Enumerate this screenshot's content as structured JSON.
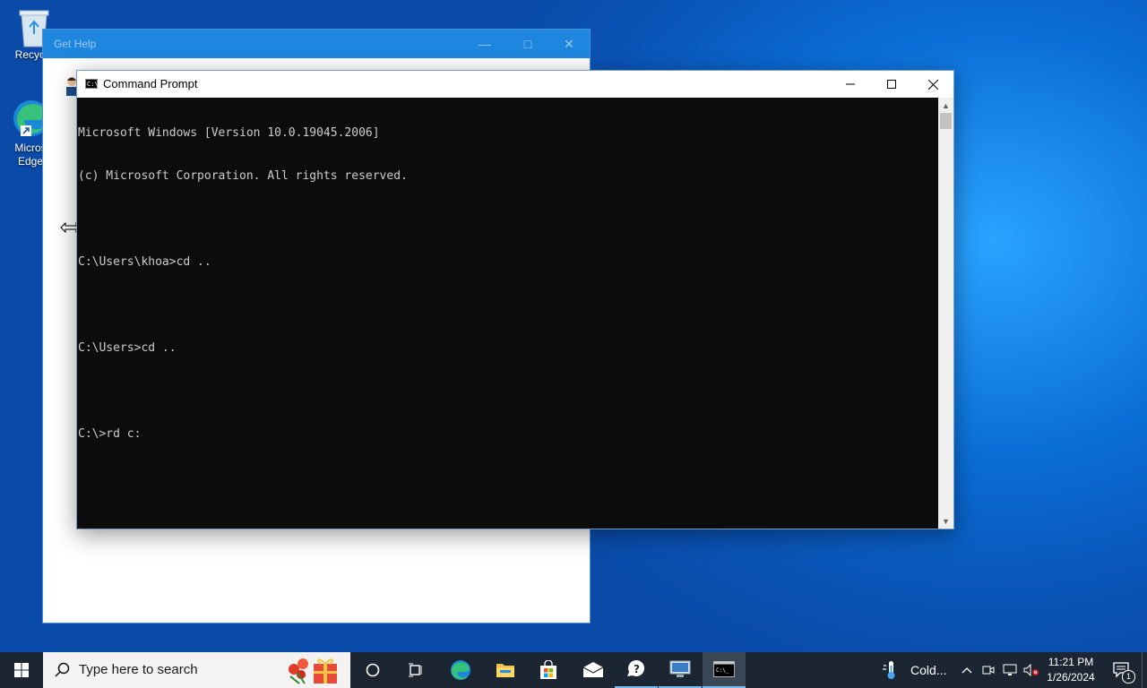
{
  "desktop": {
    "icons": [
      {
        "label": "Recycle"
      },
      {
        "label": "Micros Edge"
      }
    ]
  },
  "get_help": {
    "title": "Get Help"
  },
  "cmd": {
    "title": "Command Prompt",
    "lines": [
      "Microsoft Windows [Version 10.0.19045.2006]",
      "(c) Microsoft Corporation. All rights reserved.",
      "",
      "C:\\Users\\khoa>cd ..",
      "",
      "C:\\Users>cd ..",
      "",
      "C:\\>rd c:"
    ]
  },
  "taskbar": {
    "search_placeholder": "Type here to search",
    "weather": "Cold...",
    "time": "11:21 PM",
    "date": "1/26/2024",
    "notification_count": "1"
  },
  "colors": {
    "accent": "#0078d7",
    "console_bg": "#0c0c0c",
    "console_fg": "#cccccc",
    "taskbar_bg": "#1c2633"
  }
}
